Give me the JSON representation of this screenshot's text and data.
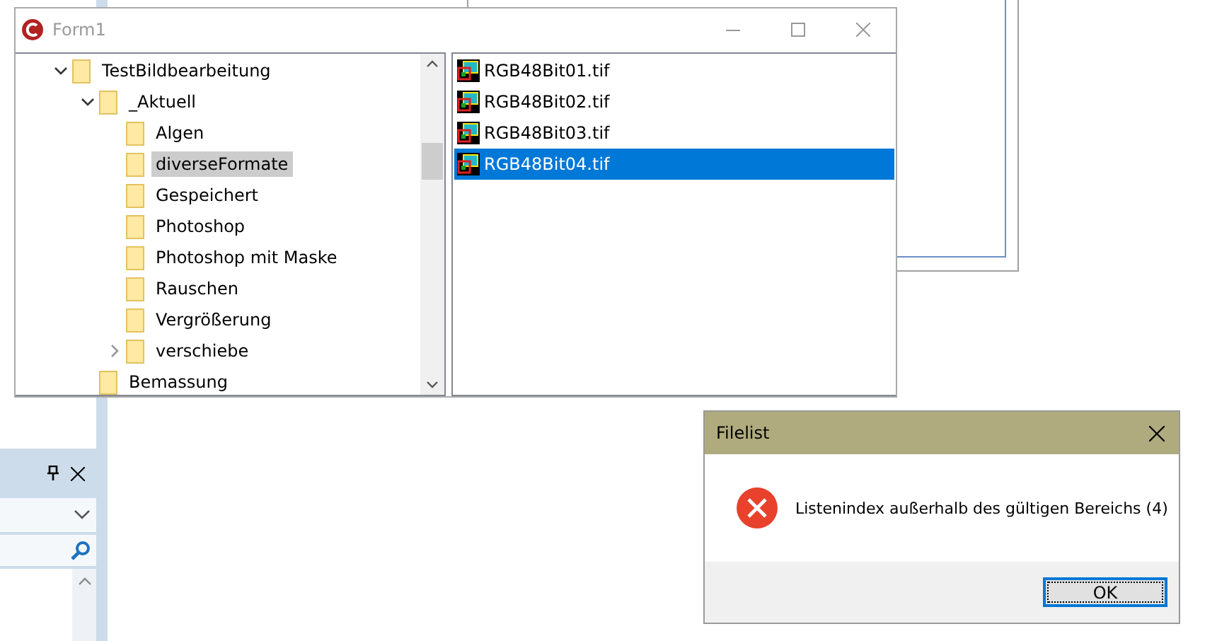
{
  "form_window": {
    "title": "Form1",
    "tree": [
      {
        "label": "TestBildbearbeitung",
        "expanded": true,
        "selected": false,
        "children": [
          {
            "label": "_Aktuell",
            "expanded": true,
            "selected": false,
            "children": [
              {
                "label": "Algen",
                "selected": false
              },
              {
                "label": "diverseFormate",
                "selected": true
              },
              {
                "label": "Gespeichert",
                "selected": false
              },
              {
                "label": "Photoshop",
                "selected": false
              },
              {
                "label": "Photoshop mit Maske",
                "selected": false
              },
              {
                "label": "Rauschen",
                "selected": false
              },
              {
                "label": "Vergrößerung",
                "selected": false
              },
              {
                "label": "verschiebe",
                "expanded": false,
                "selected": false
              }
            ]
          },
          {
            "label": "Bemassung",
            "selected": false
          }
        ]
      }
    ],
    "files": [
      {
        "name": "RGB48Bit01.tif",
        "selected": false
      },
      {
        "name": "RGB48Bit02.tif",
        "selected": false
      },
      {
        "name": "RGB48Bit03.tif",
        "selected": false
      },
      {
        "name": "RGB48Bit04.tif",
        "selected": true
      }
    ]
  },
  "message_dialog": {
    "title": "Filelist",
    "message": "Listenindex außerhalb des gültigen Bereichs (4)",
    "buttons": [
      "OK"
    ]
  }
}
